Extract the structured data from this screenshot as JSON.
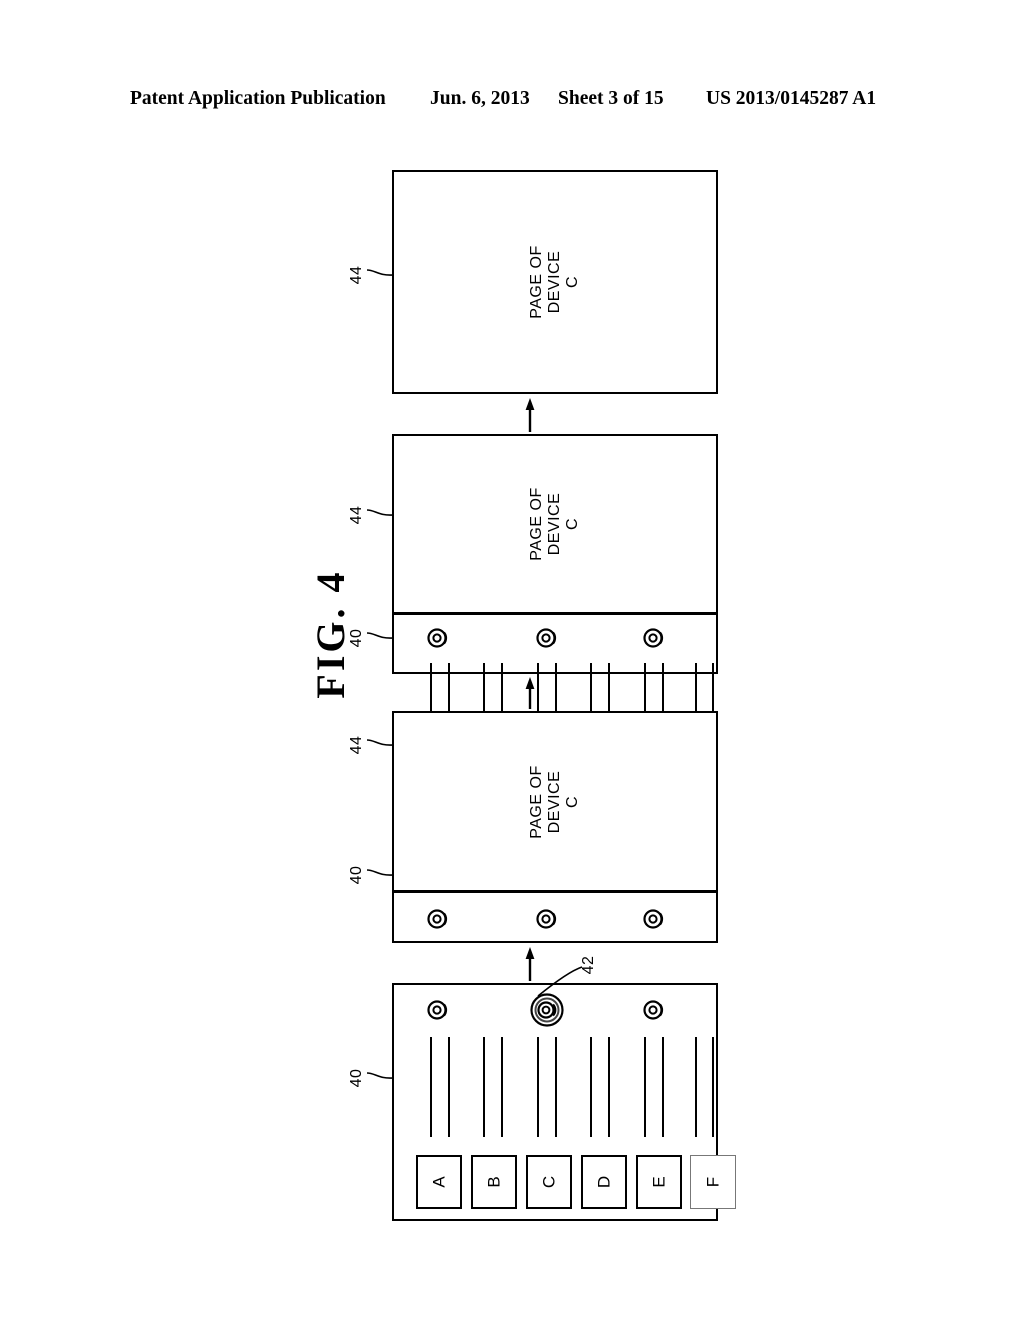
{
  "header": {
    "publication": "Patent Application Publication",
    "date": "Jun. 6, 2013",
    "sheet": "Sheet 3 of 15",
    "number": "US 2013/0145287 A1"
  },
  "figure": {
    "label": "FIG.  4",
    "orientation": "rotated-90-ccw",
    "description": "Four sequential device-screen states showing a page of device C being expanded from a browser strip to a full screen"
  },
  "callouts": [
    {
      "id": "c40-p1",
      "number": "40",
      "points_to": "browser-strip-panel-1"
    },
    {
      "id": "c42",
      "number": "42",
      "points_to": "selected-control-icon"
    },
    {
      "id": "c40-p2",
      "number": "40",
      "points_to": "browser-strip-panel-2"
    },
    {
      "id": "c44-p2",
      "number": "44",
      "points_to": "page-region-panel-2"
    },
    {
      "id": "c40-p3",
      "number": "40",
      "points_to": "browser-strip-panel-3"
    },
    {
      "id": "c44-p3",
      "number": "44",
      "points_to": "page-region-panel-3"
    },
    {
      "id": "c44-p4",
      "number": "44",
      "points_to": "page-region-panel-4"
    }
  ],
  "panels": [
    {
      "id": "panel-1",
      "order": 1,
      "has_page_region": false,
      "page_text": "",
      "control_icons": 3,
      "selected_icon_index": 1,
      "text_line_pairs": 6,
      "tabs": [
        "A",
        "B",
        "C",
        "D",
        "E",
        "F"
      ],
      "inactive_tab": "F"
    },
    {
      "id": "panel-2",
      "order": 2,
      "has_page_region": true,
      "page_text_lines": [
        "PAGE OF",
        "DEVICE",
        "C"
      ],
      "control_icons": 3,
      "selected_icon_index": -1,
      "text_line_pairs": 6,
      "tabs": []
    },
    {
      "id": "panel-3",
      "order": 3,
      "has_page_region": true,
      "page_text_lines": [
        "PAGE OF",
        "DEVICE",
        "C"
      ],
      "control_icons": 3,
      "selected_icon_index": -1,
      "text_line_pairs": 0,
      "tabs": []
    },
    {
      "id": "panel-4",
      "order": 4,
      "has_page_region": true,
      "page_text_lines": [
        "PAGE OF",
        "DEVICE",
        "C"
      ],
      "control_icons": 0,
      "selected_icon_index": -1,
      "text_line_pairs": 0,
      "tabs": []
    }
  ],
  "page_text": {
    "line1": "PAGE OF",
    "line2": "DEVICE",
    "line3": "C"
  },
  "tabs": {
    "a": "A",
    "b": "B",
    "c": "C",
    "d": "D",
    "e": "E",
    "f": "F"
  },
  "refs": {
    "forty": "40",
    "forty_two": "42",
    "forty_four": "44"
  },
  "colors": {
    "ink": "#000000",
    "paper": "#ffffff",
    "inactive": "#777777"
  }
}
